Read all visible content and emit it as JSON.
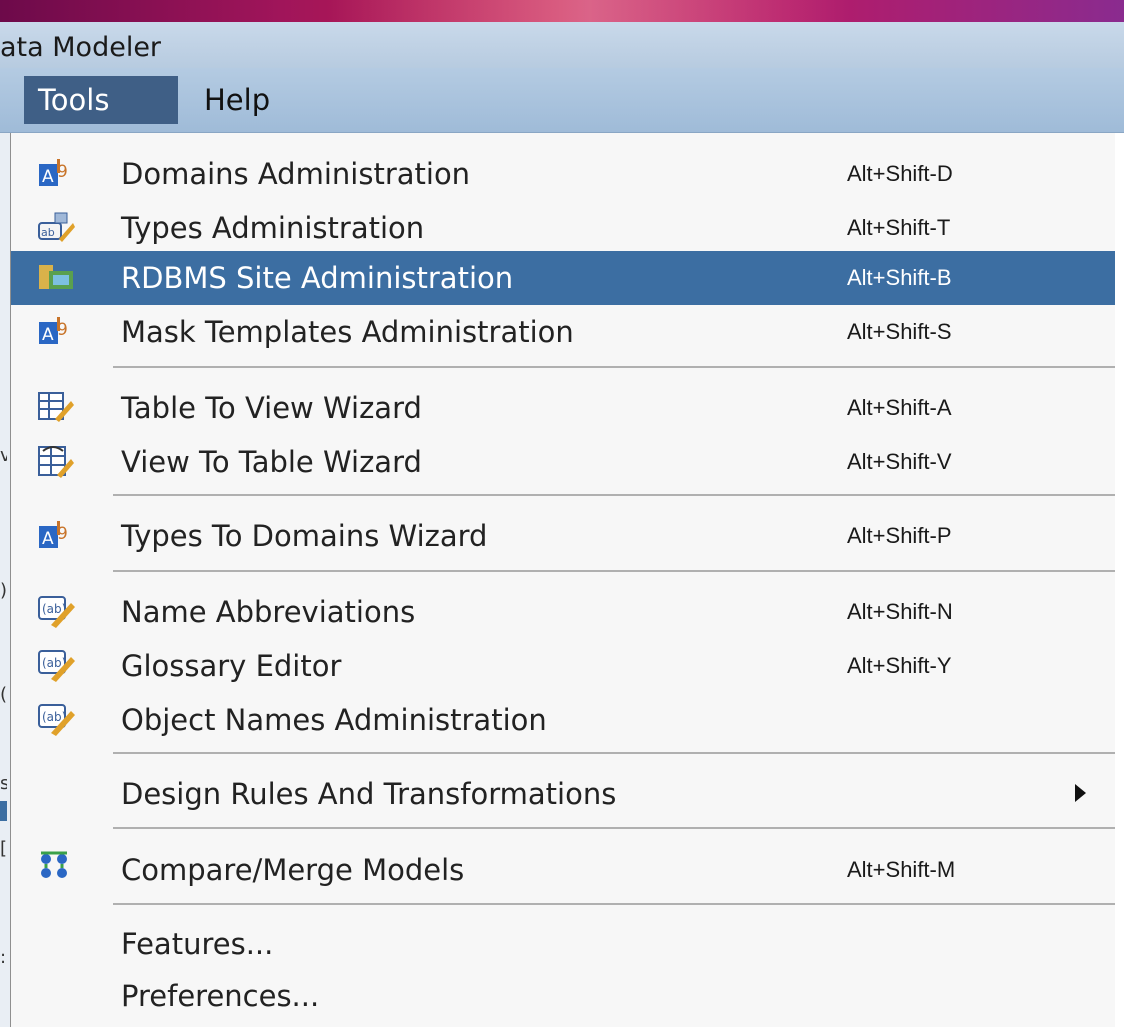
{
  "window": {
    "title": "ata Modeler"
  },
  "menubar": {
    "items": [
      "Tools",
      "Help"
    ],
    "active": "Tools"
  },
  "menu": {
    "items": [
      {
        "label": "Domains Administration",
        "shortcut": "Alt+Shift-D",
        "icon": "domains-icon"
      },
      {
        "label": "Types Administration",
        "shortcut": "Alt+Shift-T",
        "icon": "types-icon"
      },
      {
        "label": "RDBMS Site Administration",
        "shortcut": "Alt+Shift-B",
        "icon": "rdbms-site-icon",
        "highlighted": true
      },
      {
        "label": "Mask Templates Administration",
        "shortcut": "Alt+Shift-S",
        "icon": "domains-icon"
      },
      {
        "label": "Table To View Wizard",
        "shortcut": "Alt+Shift-A",
        "icon": "table-to-view-icon"
      },
      {
        "label": "View To Table Wizard",
        "shortcut": "Alt+Shift-V",
        "icon": "view-to-table-icon"
      },
      {
        "label": "Types To Domains Wizard",
        "shortcut": "Alt+Shift-P",
        "icon": "domains-icon"
      },
      {
        "label": "Name Abbreviations",
        "shortcut": "Alt+Shift-N",
        "icon": "abbreviation-icon"
      },
      {
        "label": "Glossary Editor",
        "shortcut": "Alt+Shift-Y",
        "icon": "abbreviation-icon"
      },
      {
        "label": "Object Names Administration",
        "shortcut": "",
        "icon": "abbreviation-icon"
      },
      {
        "label": "Design Rules And Transformations",
        "shortcut": "",
        "icon": "",
        "submenu": true
      },
      {
        "label": "Compare/Merge Models",
        "shortcut": "Alt+Shift-M",
        "icon": "compare-merge-icon"
      },
      {
        "label": "Features...",
        "shortcut": "",
        "icon": ""
      },
      {
        "label": "Preferences...",
        "shortcut": "",
        "icon": ""
      }
    ]
  },
  "colors": {
    "highlight": "#3c6ea2",
    "menubar_active": "#3f5f86",
    "menubar": "#a9c2dd"
  }
}
